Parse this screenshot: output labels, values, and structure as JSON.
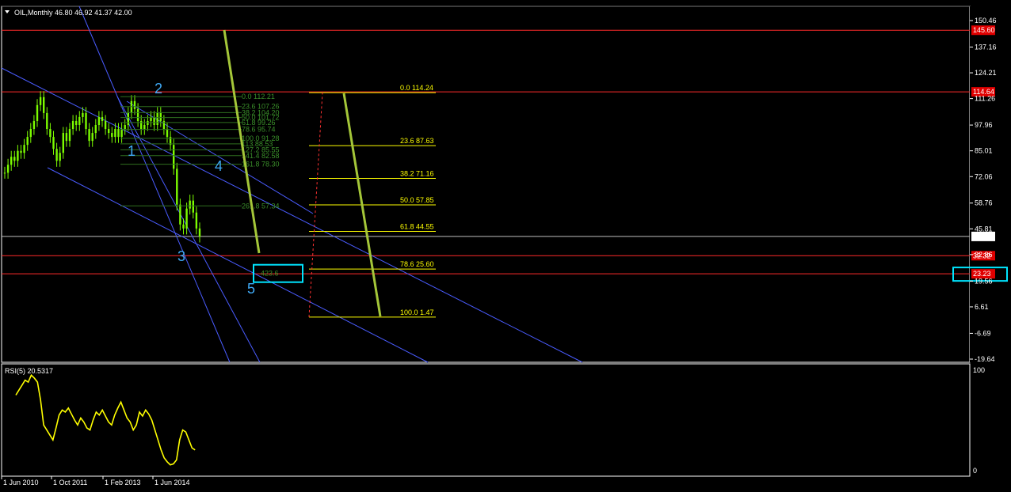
{
  "window": {
    "symbol_header": "OIL,Monthly  46.80 46.92 41.37 42.00",
    "rsi_header": "RSI(5) 20.5317"
  },
  "colors": {
    "background": "#000000",
    "candle": "#7CFC00",
    "resistance_line": "#ff2a2a",
    "channel_line": "#4a5cff",
    "fib_right": "#ffff00",
    "fib_left": "#2e7d1e",
    "projection_arrow": "#a4c639",
    "wave_label": "#3fa9f5",
    "highlight_box": "#00e5ff",
    "rsi_line": "#ffff00",
    "current_price_line": "#c0c0c0"
  },
  "chart_data": {
    "type": "candlestick",
    "title": "OIL,Monthly",
    "ohlc_last": {
      "open": 46.8,
      "high": 46.92,
      "low": 41.37,
      "close": 42.0
    },
    "price_axis_ticks": [
      "150.46",
      "137.16",
      "124.21",
      "111.26",
      "97.96",
      "85.01",
      "72.06",
      "58.76",
      "45.81",
      "32.86",
      "19.56",
      "6.61",
      "-6.69",
      "-19.64"
    ],
    "ylim": [
      -19.64,
      150.46
    ],
    "time_axis_labels": [
      "1 Jun 2010",
      "1 Oct 2011",
      "1 Feb 2013",
      "1 Jun 2014"
    ],
    "price_tags": [
      {
        "label": "145.60",
        "kind": "red"
      },
      {
        "label": "114.64",
        "kind": "red"
      },
      {
        "label": "42.00",
        "kind": "current"
      },
      {
        "label": "32.32",
        "kind": "red"
      },
      {
        "label": "23.23",
        "kind": "red"
      }
    ],
    "horizontal_lines": [
      145.6,
      114.64,
      42.0,
      32.32,
      23.23
    ],
    "close_series": [
      74,
      78,
      82,
      80,
      85,
      84,
      88,
      92,
      96,
      100,
      108,
      112,
      104,
      96,
      92,
      86,
      80,
      84,
      94,
      90,
      96,
      100,
      98,
      102,
      104,
      96,
      90,
      94,
      98,
      102,
      100,
      96,
      94,
      92,
      96,
      92,
      96,
      98,
      104,
      110,
      106,
      100,
      96,
      98,
      100,
      102,
      98,
      104,
      100,
      96,
      92,
      88,
      76,
      58,
      48,
      46,
      56,
      60,
      54,
      46,
      42
    ],
    "wave_labels": [
      "1",
      "2",
      "3",
      "4",
      "5"
    ],
    "fib_right": {
      "levels": [
        {
          "label": "0.0 114.24",
          "value": 114.24
        },
        {
          "label": "23.6 87.63",
          "value": 87.63
        },
        {
          "label": "38.2 71.16",
          "value": 71.16
        },
        {
          "label": "50.0 57.85",
          "value": 57.85
        },
        {
          "label": "61.8 44.55",
          "value": 44.55
        },
        {
          "label": "78.6 25.60",
          "value": 25.6
        },
        {
          "label": "100.0 1.47",
          "value": 1.47
        }
      ]
    },
    "fib_left": {
      "levels": [
        {
          "label": "0.0 112.21",
          "value": 112.21
        },
        {
          "label": "23.6 107.26",
          "value": 107.26
        },
        {
          "label": "38.2 104.20",
          "value": 104.2
        },
        {
          "label": "50.0 101.72",
          "value": 101.72
        },
        {
          "label": "61.8 99.26",
          "value": 99.26
        },
        {
          "label": "78.6 95.74",
          "value": 95.74
        },
        {
          "label": "100.0 91.28",
          "value": 91.28
        },
        {
          "label": "113.88.53",
          "value": 88.53
        },
        {
          "label": "127.2 85.55",
          "value": 85.55
        },
        {
          "label": "141.4 82.58",
          "value": 82.58
        },
        {
          "label": "161.8 78.30",
          "value": 78.3
        },
        {
          "label": "261.8 57.34",
          "value": 57.34
        },
        {
          "label": "423.6",
          "value": 23.4
        }
      ]
    },
    "rsi": {
      "period": 5,
      "last_value": 20.5317,
      "axis_ticks": [
        "100",
        "0"
      ],
      "ylim": [
        0,
        100
      ],
      "values": [
        75,
        80,
        85,
        90,
        88,
        95,
        92,
        88,
        70,
        45,
        40,
        35,
        30,
        42,
        55,
        60,
        58,
        62,
        56,
        50,
        45,
        52,
        48,
        42,
        40,
        50,
        58,
        55,
        60,
        54,
        48,
        45,
        55,
        62,
        68,
        60,
        52,
        48,
        40,
        45,
        58,
        54,
        60,
        56,
        50,
        40,
        30,
        20,
        12,
        8,
        5,
        6,
        10,
        30,
        40,
        38,
        30,
        22,
        20
      ]
    }
  }
}
